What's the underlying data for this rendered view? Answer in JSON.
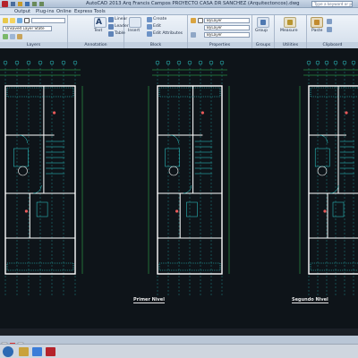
{
  "window": {
    "title": "AutoCAD 2013   Arq Francis Campos PROYECTO CASA DR SANCHEZ (Arquitectoncos).dwg",
    "search_placeholder": "Type a keyword or phrase"
  },
  "menu_tabs": [
    "Output",
    "Plug-ins",
    "Online",
    "Express Tools"
  ],
  "ribbon": {
    "panels": {
      "layers": "Layers",
      "annotation": "Annotation",
      "block": "Block",
      "properties": "Properties",
      "groups": "Groups",
      "utilities": "Utilities",
      "clipboard": "Clipboard"
    },
    "layers": {
      "layer_state": "Unsaved Layer State"
    },
    "annotation": {
      "text": "Text",
      "linear": "Linear",
      "leader": "Leader",
      "table": "Table"
    },
    "block": {
      "insert": "Insert",
      "create": "Create",
      "edit": "Edit",
      "edit_attributes": "Edit Attributes"
    },
    "properties": {
      "color": "ByLayer",
      "linetype": "ByLayer",
      "lineweight": "ByLayer"
    },
    "groups": {
      "group": "Group"
    },
    "utilities": {
      "measure": "Measure"
    },
    "clipboard": {
      "paste": "Paste"
    }
  },
  "drawing": {
    "plan_labels": {
      "first_floor": "Primer Nivel",
      "second_floor": "Segundo Nivel"
    },
    "colors": {
      "background": "#0e1419",
      "walls": "#ffffff",
      "annotation": "#2fd6d6",
      "dimension": "#34c759",
      "accent": "#e85a5a"
    }
  },
  "taskbar": {
    "start_icon": "windows-start-icon"
  }
}
